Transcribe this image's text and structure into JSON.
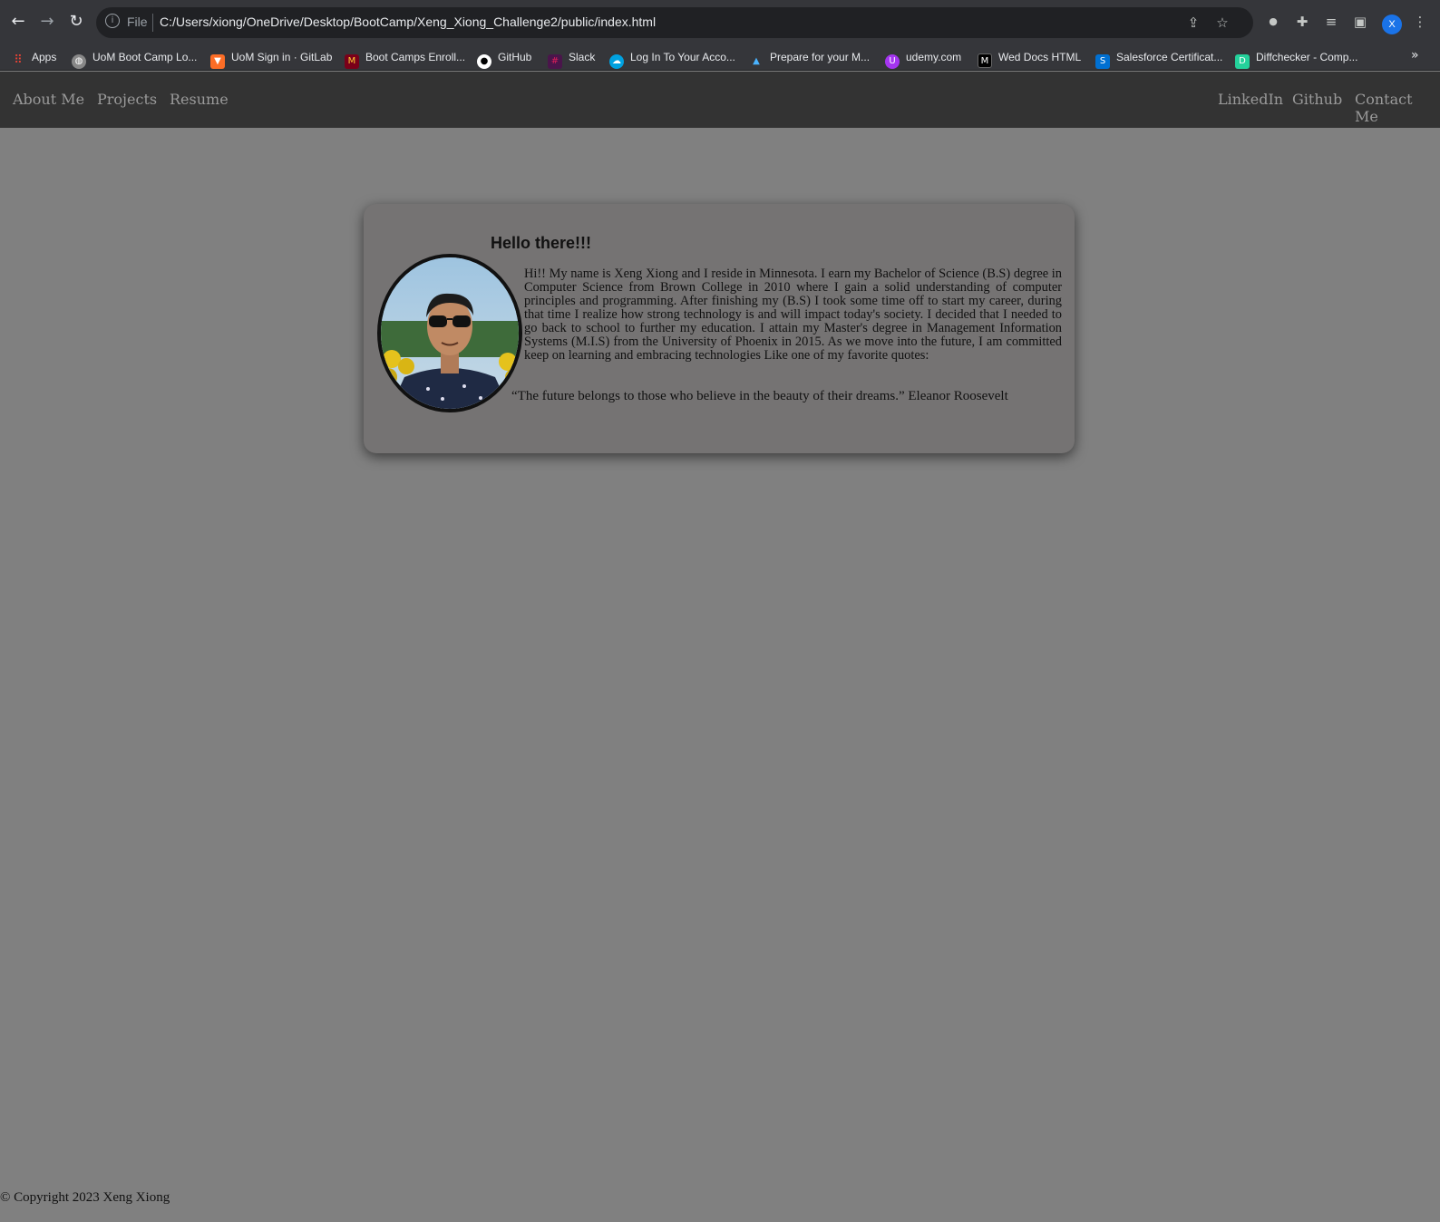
{
  "browser": {
    "file_label": "File",
    "url": "C:/Users/xiong/OneDrive/Desktop/BootCamp/Xeng_Xiong_Challenge2/public/index.html",
    "profile_initial": "X",
    "icons": [
      "back-icon",
      "forward-icon",
      "reload-icon",
      "info-icon",
      "share-icon",
      "star-icon",
      "extension-icon",
      "puzzle-icon",
      "reading-list-icon",
      "side-panel-icon",
      "menu-icon"
    ]
  },
  "bookmarks": {
    "items": [
      {
        "label": "Apps",
        "icon": "apps-grid-icon",
        "color": "#ea4335"
      },
      {
        "label": "UoM Boot Camp Lo...",
        "icon": "globe-icon",
        "color": "#888888"
      },
      {
        "label": "UoM Sign in · GitLab",
        "icon": "gitlab-icon",
        "color": "#fc6d26"
      },
      {
        "label": "Boot Camps Enroll...",
        "icon": "umn-icon",
        "color": "#7a0019"
      },
      {
        "label": "GitHub",
        "icon": "github-icon",
        "color": "#ffffff"
      },
      {
        "label": "Slack",
        "icon": "slack-icon",
        "color": "#e01e5a"
      },
      {
        "label": "Log In To Your Acco...",
        "icon": "salesforce-cloud-icon",
        "color": "#00a1e0"
      },
      {
        "label": "Prepare for your M...",
        "icon": "prepare-icon",
        "color": "#4ab3ff"
      },
      {
        "label": "udemy.com",
        "icon": "udemy-icon",
        "color": "#a435f0"
      },
      {
        "label": "Wed Docs HTML",
        "icon": "mdn-icon",
        "color": "#000000"
      },
      {
        "label": "Salesforce Certificat...",
        "icon": "salesforce-icon",
        "color": "#0070d2"
      },
      {
        "label": "Diffchecker - Comp...",
        "icon": "diffchecker-icon",
        "color": "#24d19b"
      }
    ],
    "more": "»"
  },
  "nav": {
    "left": [
      "About Me",
      "Projects",
      "Resume"
    ],
    "right": [
      "LinkedIn",
      "Github",
      "Contact Me"
    ]
  },
  "card": {
    "title": "Hello there!!!",
    "bio": "Hi!! My name is Xeng Xiong and I reside in Minnesota. I earn my Bachelor of Science (B.S) degree in Computer Science from Brown College in 2010 where I gain a solid understanding of computer principles and programming. After finishing my (B.S) I took some time off to start my career, during that time I realize how strong technology is and will impact today's society. I decided that I needed to go back to school to further my education. I attain my Master's degree in Management Information Systems (M.I.S) from the University of Phoenix in 2015. As we move into the future, I am committed keep on learning and embracing technologies Like one of my favorite quotes:",
    "quote": "“The future belongs to those who believe in the beauty of their dreams.” Eleanor Roosevelt"
  },
  "footer": {
    "text": "© Copyright 2023 Xeng Xiong"
  },
  "colors": {
    "page_bg": "#808080",
    "nav_bg": "#333333",
    "card_bg": "#757373",
    "chrome_bg": "#35363a"
  }
}
